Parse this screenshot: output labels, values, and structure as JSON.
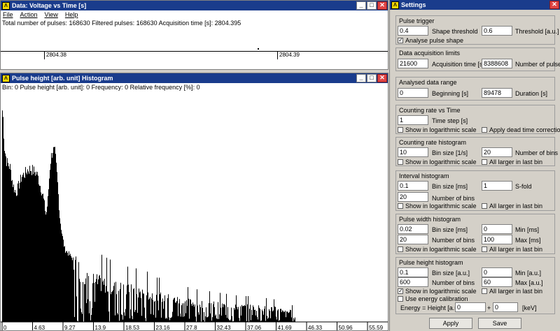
{
  "top_window": {
    "title": "Data: Voltage vs Time [s]",
    "menu": [
      "File",
      "Action",
      "View",
      "Help"
    ],
    "info": "Total number of pulses: 168630  Filtered pulses: 168630  Acquisition time [s]: 2804.395",
    "ticks": [
      "2804.38",
      "2804.39"
    ]
  },
  "hist_window": {
    "title": "Pulse height [arb. unit] Histogram",
    "info": "Bin: 0  Pulse height [arb. unit]: 0  Frequency: 0  Relative frequency [%]: 0"
  },
  "chart_data": {
    "type": "bar",
    "x_ticks": [
      "0",
      "4.63",
      "9.27",
      "13.9",
      "18.53",
      "23.16",
      "27.8",
      "32.43",
      "37.06",
      "41.69",
      "46.33",
      "50.96",
      "55.59"
    ],
    "xlim": [
      0,
      60
    ],
    "ylog": true,
    "grid": false,
    "envelope": [
      [
        0,
        0.98
      ],
      [
        0.3,
        0.95
      ],
      [
        0.6,
        0.78
      ],
      [
        1.0,
        0.72
      ],
      [
        1.5,
        0.7
      ],
      [
        2.0,
        0.62
      ],
      [
        2.5,
        0.58
      ],
      [
        3.0,
        0.62
      ],
      [
        3.5,
        0.66
      ],
      [
        4.0,
        0.67
      ],
      [
        4.5,
        0.69
      ],
      [
        5.0,
        0.69
      ],
      [
        5.5,
        0.68
      ],
      [
        6.0,
        0.67
      ],
      [
        6.5,
        0.62
      ],
      [
        7.0,
        0.57
      ],
      [
        7.5,
        0.48
      ],
      [
        7.8,
        0.55
      ],
      [
        8.2,
        0.72
      ],
      [
        8.6,
        0.78
      ],
      [
        9.0,
        0.76
      ],
      [
        9.4,
        0.64
      ],
      [
        9.8,
        0.47
      ],
      [
        10.2,
        0.39
      ],
      [
        10.6,
        0.33
      ],
      [
        11.2,
        0.31
      ],
      [
        11.8,
        0.29
      ],
      [
        12.5,
        0.27
      ],
      [
        13.2,
        0.24
      ],
      [
        14.0,
        0.22
      ],
      [
        15.0,
        0.2
      ],
      [
        16.0,
        0.19
      ],
      [
        17.0,
        0.18
      ],
      [
        18.0,
        0.17
      ],
      [
        19.0,
        0.165
      ],
      [
        20.0,
        0.16
      ],
      [
        21.0,
        0.15
      ],
      [
        22.0,
        0.15
      ],
      [
        23.0,
        0.14
      ],
      [
        24.0,
        0.14
      ],
      [
        25.0,
        0.13
      ],
      [
        26.0,
        0.12
      ],
      [
        27.0,
        0.12
      ],
      [
        28.0,
        0.11
      ],
      [
        29.0,
        0.105
      ],
      [
        30.0,
        0.1
      ],
      [
        32.0,
        0.09
      ],
      [
        34.0,
        0.085
      ],
      [
        36.0,
        0.08
      ],
      [
        38.0,
        0.075
      ],
      [
        40.0,
        0.07
      ],
      [
        42.0,
        0.07
      ],
      [
        44.0,
        0.065
      ],
      [
        46.0,
        0.06
      ],
      [
        48.0,
        0.05
      ],
      [
        49.0,
        0.04
      ]
    ]
  },
  "settings": {
    "title": "Settings",
    "pulse_trigger": {
      "title": "Pulse trigger",
      "shape_threshold_val": "0.4",
      "shape_threshold_lbl": "Shape threshold",
      "threshold_val": "0.6",
      "threshold_lbl": "Threshold [a.u.]",
      "analyse_lbl": "Analyse pulse shape"
    },
    "acq_limits": {
      "title": "Data acquisition limits",
      "acq_time_val": "21600",
      "acq_time_lbl": "Acquisition time [s]",
      "num_pulses_val": "8388608",
      "num_pulses_lbl": "Number of pulses"
    },
    "analysed_range": {
      "title": "Analysed data range",
      "beginning_val": "0",
      "beginning_lbl": "Beginning [s]",
      "duration_val": "89478",
      "duration_lbl": "Duration [s]"
    },
    "counting_rate": {
      "title": "Counting rate vs Time",
      "time_step_val": "1",
      "time_step_lbl": "Time step [s]",
      "log_lbl": "Show in logarithmic scale",
      "dead_time_lbl": "Apply dead time correction"
    },
    "counting_hist": {
      "title": "Counting rate histogram",
      "bin_size_val": "10",
      "bin_size_lbl": "Bin size [1/s]",
      "num_bins_val": "20",
      "num_bins_lbl": "Number of bins",
      "log_lbl": "Show in logarithmic scale",
      "larger_lbl": "All larger in last bin"
    },
    "interval_hist": {
      "title": "Interval histogram",
      "bin_size_val": "0.1",
      "bin_size_lbl": "Bin size [ms]",
      "sfold_val": "1",
      "sfold_lbl": "S-fold",
      "num_bins_val": "20",
      "num_bins_lbl": "Number of bins",
      "log_lbl": "Show in logarithmic scale",
      "larger_lbl": "All larger in last bin"
    },
    "width_hist": {
      "title": "Pulse width histogram",
      "bin_size_val": "0.02",
      "bin_size_lbl": "Bin size [ms]",
      "min_val": "0",
      "min_lbl": "Min [ms]",
      "num_bins_val": "20",
      "num_bins_lbl": "Number of bins",
      "max_val": "100",
      "max_lbl": "Max [ms]",
      "log_lbl": "Show in logarithmic scale",
      "larger_lbl": "All larger in last bin"
    },
    "height_hist": {
      "title": "Pulse height histogram",
      "bin_size_val": "0.1",
      "bin_size_lbl": "Bin size [a.u.]",
      "min_val": "0",
      "min_lbl": "Min [a.u.]",
      "num_bins_val": "600",
      "num_bins_lbl": "Number of bins",
      "max_val": "60",
      "max_lbl": "Max [a.u.]",
      "log_lbl": "Show in logarithmic scale",
      "larger_lbl": "All larger in last bin",
      "energy_cal_lbl": "Use energy calibration",
      "energy_eq_lbl": "Energy = Height [a.u] x",
      "mult_val": "0",
      "plus_lbl": "+",
      "offset_val": "0",
      "kev_lbl": "[keV]"
    },
    "apply_label": "Apply",
    "save_label": "Save"
  }
}
